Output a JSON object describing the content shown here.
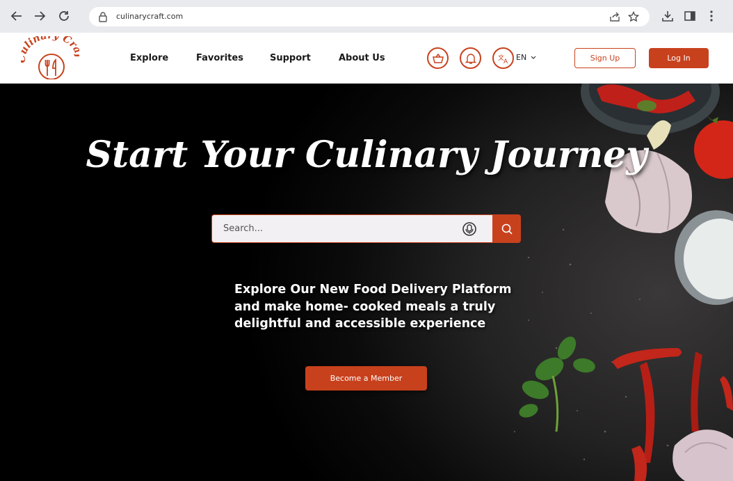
{
  "browser": {
    "url": "culinarycraft.com",
    "icons": [
      "back-icon",
      "forward-icon",
      "reload-icon",
      "lock-icon",
      "share-icon",
      "star-icon",
      "download-icon",
      "sidebar-icon",
      "menu-dots-icon"
    ]
  },
  "header": {
    "logo_text": "Culinary Craft",
    "nav": [
      "Explore",
      "Favorites",
      "Support",
      "About Us"
    ],
    "icons": [
      "basket-icon",
      "bell-icon",
      "translate-icon"
    ],
    "language": "EN",
    "signup_label": "Sign Up",
    "login_label": "Log In"
  },
  "hero": {
    "title": "Start Your Culinary Journey",
    "search_placeholder": "Search...",
    "description_lines": [
      "Explore Our New Food Delivery Platform",
      "and make home- cooked meals a truly",
      "delightful and accessible experience"
    ],
    "cta_label": "Become a Member"
  },
  "colors": {
    "accent": "#c8411d",
    "header_bg": "#ffffff",
    "browser_bg": "#e8eaee",
    "hero_bg": "#000000"
  }
}
